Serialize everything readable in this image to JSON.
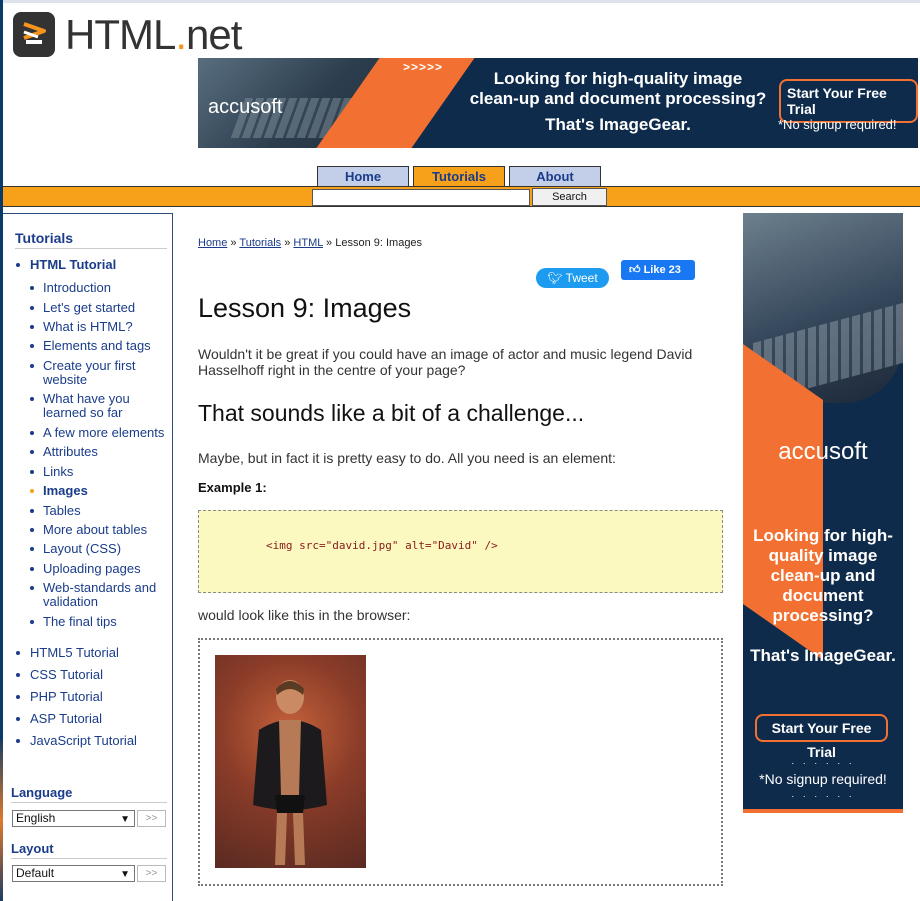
{
  "site": {
    "logo_main": "HTML",
    "logo_dot": ".",
    "logo_suffix": "net"
  },
  "ad_top": {
    "brand": "accusoft",
    "arrows": ">>>>>",
    "line1": "Looking for high-quality image",
    "line2": "clean-up and document processing?",
    "line3": "That's ImageGear.",
    "cta": "Start Your Free Trial",
    "note": "*No signup required!"
  },
  "nav": {
    "tabs": [
      {
        "label": "Home",
        "active": false
      },
      {
        "label": "Tutorials",
        "active": true
      },
      {
        "label": "About",
        "active": false
      }
    ],
    "search_button": "Search",
    "search_value": ""
  },
  "sidebar": {
    "heading": "Tutorials",
    "html_tutorial": "HTML Tutorial",
    "lessons": [
      "Introduction",
      "Let's get started",
      "What is HTML?",
      "Elements and tags",
      "Create your first website",
      "What have you learned so far",
      "A few more elements",
      "Attributes",
      "Links",
      "Images",
      "Tables",
      "More about tables",
      "Layout (CSS)",
      "Uploading pages",
      "Web-standards and validation",
      "The final tips"
    ],
    "current_lesson": "Images",
    "other_tutorials": [
      "HTML5 Tutorial",
      "CSS Tutorial",
      "PHP Tutorial",
      "ASP Tutorial",
      "JavaScript Tutorial"
    ],
    "language_heading": "Language",
    "language_value": "English",
    "layout_heading": "Layout",
    "layout_value": "Default",
    "go_label": ">>"
  },
  "breadcrumb": {
    "home": "Home",
    "tutorials": "Tutorials",
    "html": "HTML",
    "current": "Lesson 9: Images",
    "sep": "»"
  },
  "social": {
    "tweet": "Tweet",
    "like": "Like 23"
  },
  "content": {
    "title": "Lesson 9: Images",
    "intro": "Wouldn't it be great if you could have an image of actor and music legend David Hasselhoff right in the centre of your page?",
    "subheading": "That sounds like a bit of a challenge...",
    "para2": "Maybe, but in fact it is pretty easy to do. All you need is an element:",
    "example_label": "Example 1:",
    "code": "<img src=\"david.jpg\" alt=\"David\" />",
    "para3": "would look like this in the browser:"
  },
  "ad_right": {
    "brand": "accusoft",
    "msg1": "Looking for high-quality image clean-up and document processing?",
    "msg2": "That's ImageGear.",
    "cta": "Start Your Free Trial",
    "note": "*No signup required!",
    "dots": "· · · · · ·"
  },
  "colors": {
    "accent": "#f7a11a",
    "link": "#1a3c8a",
    "tab_bg": "#c3cfe9",
    "ad_orange": "#f27132",
    "ad_navy": "#0f2b4c",
    "code_bg": "#fbf8c0"
  }
}
